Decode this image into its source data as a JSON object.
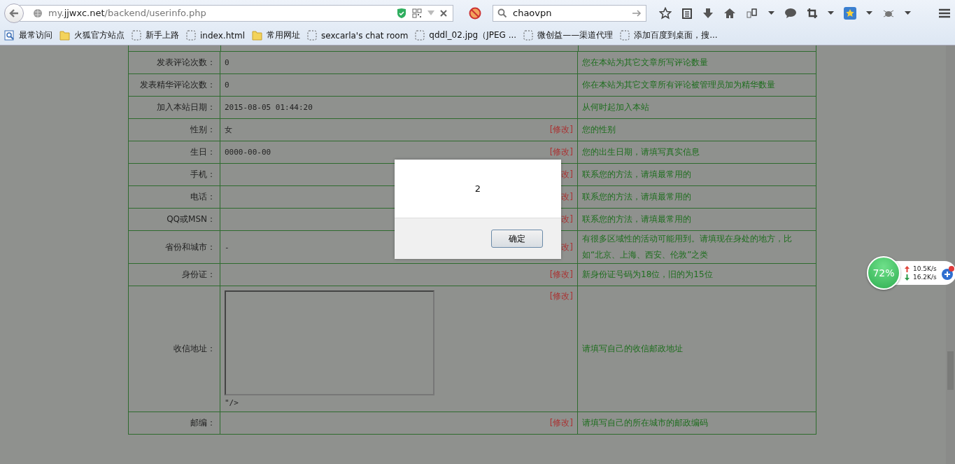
{
  "browser": {
    "url": {
      "prefix": "my.",
      "domain": "jjwxc.net",
      "path": "/backend/userinfo.php"
    },
    "search": {
      "value": "chaovpn"
    },
    "bookmarks": [
      {
        "kind": "history",
        "label": "最常访问"
      },
      {
        "kind": "folder",
        "label": "火狐官方站点"
      },
      {
        "kind": "page",
        "label": "新手上路"
      },
      {
        "kind": "page",
        "label": "index.html"
      },
      {
        "kind": "folder",
        "label": "常用网址"
      },
      {
        "kind": "page",
        "label": "sexcarla's chat room"
      },
      {
        "kind": "page",
        "label": "qddl_02.jpg（JPEG ..."
      },
      {
        "kind": "page",
        "label": "微创益——渠道代理"
      },
      {
        "kind": "page",
        "label": "添加百度到桌面，搜..."
      }
    ]
  },
  "table": {
    "rows": [
      {
        "kind": "text",
        "label": "发表评论次数：",
        "value": "0",
        "description": "您在本站为其它文章所写评论数量"
      },
      {
        "kind": "text",
        "label": "发表精华评论次数：",
        "value": "0",
        "description": "你在本站为其它文章所有评论被管理员加为精华数量"
      },
      {
        "kind": "text",
        "label": "加入本站日期：",
        "value": "2015-08-05 01:44:20",
        "description": "从何时起加入本站"
      },
      {
        "kind": "text",
        "label": "性别：",
        "value": "女",
        "edit": "[修改]",
        "description": "您的性别"
      },
      {
        "kind": "text",
        "label": "生日：",
        "value": "0000-00-00",
        "edit": "[修改]",
        "description": "您的出生日期，请填写真实信息"
      },
      {
        "kind": "text",
        "label": "手机：",
        "edit": "改]",
        "description": "联系您的方法，请填最常用的"
      },
      {
        "kind": "text",
        "label": "电话：",
        "edit": "改]",
        "description": "联系您的方法，请填最常用的"
      },
      {
        "kind": "text",
        "label": "QQ或MSN：",
        "edit": "改]",
        "description": "联系您的方法，请填最常用的"
      },
      {
        "kind": "text",
        "label": "省份和城市：",
        "value": "-",
        "edit": "改]",
        "description": "有很多区域性的活动可能用到。请填现在身处的地方，比如“北京、上海、西安、伦敦”之类"
      },
      {
        "kind": "text",
        "label": "身份证：",
        "edit": "[修改]",
        "description": "新身份证号码为18位，旧的为15位"
      },
      {
        "kind": "textarea",
        "label": "收信地址：",
        "value": "\"/>",
        "edit": "[修改]",
        "description": "请填写自己的收信邮政地址"
      },
      {
        "kind": "text",
        "label": "邮编：",
        "edit": "[修改]",
        "description": "请填写自己的所在城市的邮政编码"
      }
    ]
  },
  "dialog": {
    "message": "2",
    "button": "确定"
  },
  "speed_widget": {
    "percent": "72%",
    "upload": "10.5K/s",
    "download": "16.2K/s"
  }
}
